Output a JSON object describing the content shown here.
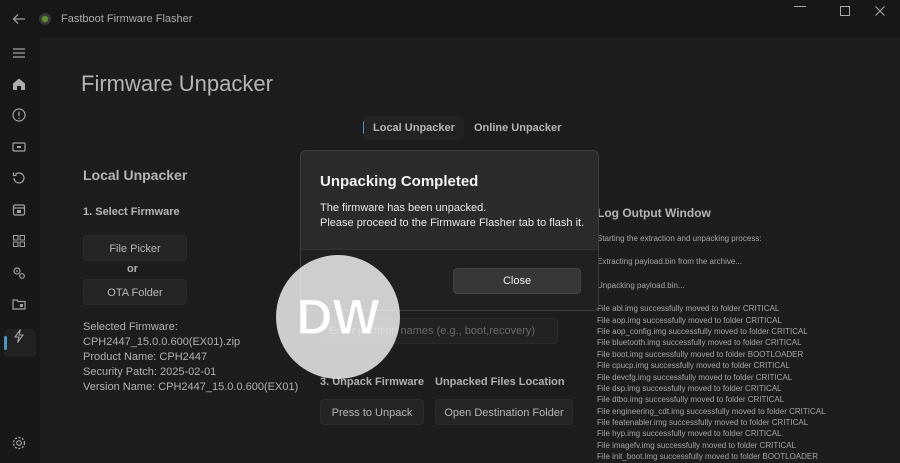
{
  "window": {
    "title": "Fastboot Firmware Flasher",
    "minimize_icon": "minimize-icon",
    "maximize_icon": "maximize-icon",
    "close_icon": "close-icon"
  },
  "sidebar": {
    "items": [
      {
        "icon": "hamburger-menu-icon"
      },
      {
        "icon": "home-icon"
      },
      {
        "icon": "info-icon"
      },
      {
        "icon": "device-icon"
      },
      {
        "icon": "history-icon"
      },
      {
        "icon": "calendar-icon"
      },
      {
        "icon": "apps-grid-icon"
      },
      {
        "icon": "gears-icon"
      },
      {
        "icon": "unpacker-icon"
      },
      {
        "icon": "flash-icon"
      },
      {
        "icon": "settings-icon"
      }
    ],
    "active_color": "#60cdff"
  },
  "page": {
    "title": "Firmware Unpacker",
    "tabs": [
      {
        "label": "Local Unpacker",
        "active": true
      },
      {
        "label": "Online Unpacker",
        "active": false
      }
    ]
  },
  "local": {
    "section_title": "Local Unpacker",
    "step1_label": "1. Select Firmware",
    "file_picker_label": "File Picker",
    "or_label": "or",
    "ota_folder_label": "OTA Folder",
    "info": [
      "Selected Firmware:",
      "CPH2447_15.0.0.600(EX01).zip",
      "Product Name: CPH2447",
      "Security Patch: 2025-02-01",
      "Version Name: CPH2447_15.0.0.600(EX01)"
    ],
    "partition_placeholder": "Enter partition names (e.g., boot,recovery)",
    "step3_label": "3. Unpack Firmware",
    "press_to_unpack_label": "Press to Unpack",
    "unpacked_location_label": "Unpacked Files Location",
    "open_destination_label": "Open Destination Folder"
  },
  "log": {
    "title": "Log Output Window",
    "intro_lines": [
      "Starting the extraction and unpacking process:",
      "Extracting payload.bin from the archive...",
      "Unpacking payload.bin..."
    ],
    "lines": [
      "File abl.img successfully moved to folder CRITICAL",
      "File aop.img successfully moved to folder CRITICAL",
      "File aop_config.img successfully moved to folder CRITICAL",
      "File bluetooth.img successfully moved to folder CRITICAL",
      "File boot.img successfully moved to folder BOOTLOADER",
      "File cpucp.img successfully moved to folder CRITICAL",
      "File devcfg.img successfully moved to folder CRITICAL",
      "File dsp.img successfully moved to folder CRITICAL",
      "File dtbo.img successfully moved to folder CRITICAL",
      "File engineering_cdt.img successfully moved to folder CRITICAL",
      "File featenabler.img successfully moved to folder CRITICAL",
      "File hyp.img successfully moved to folder CRITICAL",
      "File imagefv.img successfully moved to folder CRITICAL",
      "File init_boot.img successfully moved to folder BOOTLOADER"
    ]
  },
  "dialog": {
    "title": "Unpacking Completed",
    "message_line1": "The firmware has been unpacked.",
    "message_line2": "Please proceed to the Firmware Flasher tab to flash it.",
    "close_label": "Close"
  },
  "watermark": {
    "text": "DW"
  }
}
